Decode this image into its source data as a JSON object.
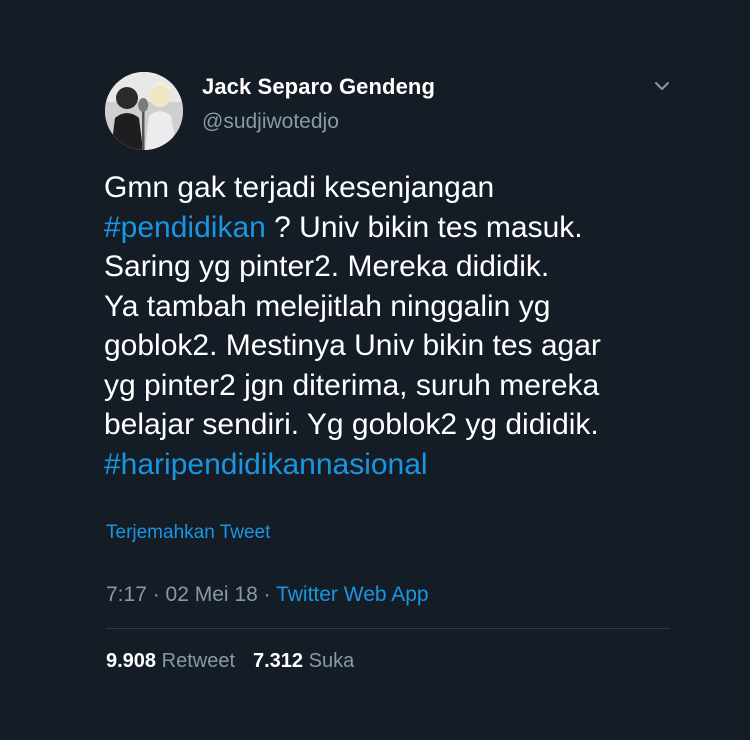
{
  "user": {
    "display_name": "Jack Separo Gendeng",
    "handle": "@sudjiwotedjo",
    "avatar_icon": "profile-photo"
  },
  "menu": {
    "icon": "chevron-down-icon"
  },
  "tweet": {
    "lines": [
      [
        {
          "t": "Gmn gak terjadi kesenjangan",
          "tag": false
        }
      ],
      [
        {
          "t": "#pendidikan",
          "tag": true
        },
        {
          "t": " ? Univ bikin tes masuk.",
          "tag": false
        }
      ],
      [
        {
          "t": "Saring yg pinter2. Mereka dididik.",
          "tag": false
        }
      ],
      [
        {
          "t": "Ya tambah melejitlah ninggalin yg",
          "tag": false
        }
      ],
      [
        {
          "t": "goblok2. Mestinya Univ bikin tes agar",
          "tag": false
        }
      ],
      [
        {
          "t": "yg pinter2 jgn diterima, suruh mereka",
          "tag": false
        }
      ],
      [
        {
          "t": "belajar sendiri. Yg goblok2 yg dididik.",
          "tag": false
        }
      ],
      [
        {
          "t": "#haripendidikannasional",
          "tag": true
        }
      ]
    ],
    "translate_label": "Terjemahkan Tweet"
  },
  "meta": {
    "time": "7:17",
    "separator": " · ",
    "date": "02 Mei 18",
    "source": "Twitter Web App"
  },
  "stats": {
    "retweet_count": "9.908",
    "retweet_label": "Retweet",
    "like_count": "7.312",
    "like_label": "Suka"
  },
  "colors": {
    "background": "#141d26",
    "text": "#ffffff",
    "muted": "#8899a6",
    "link": "#1b95e0"
  }
}
